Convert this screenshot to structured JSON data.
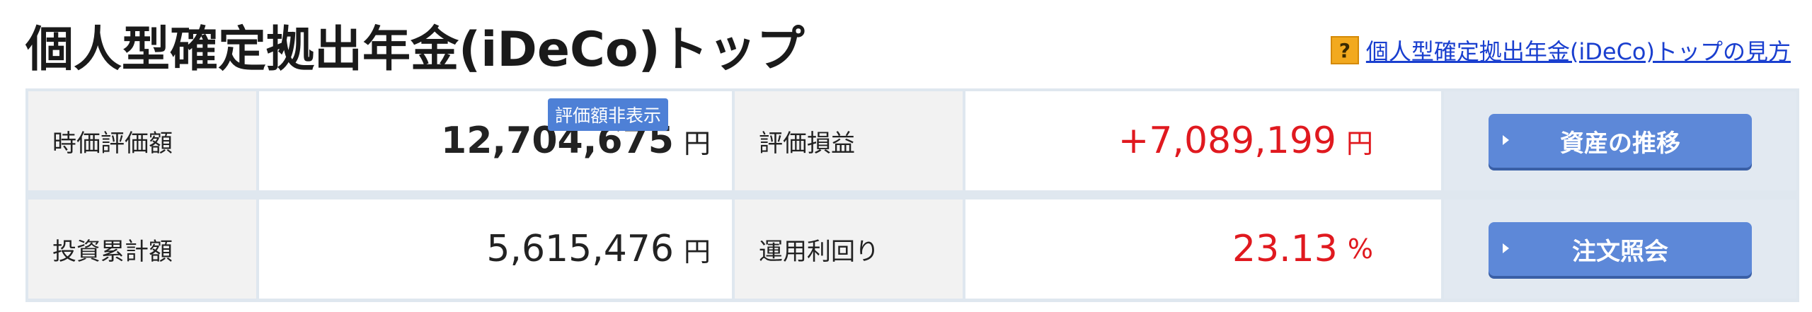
{
  "header": {
    "title": "個人型確定拠出年金(iDeCo)トップ",
    "help_icon": "?",
    "help_link": "個人型確定拠出年金(iDeCo)トップの見方"
  },
  "summary": {
    "market_value": {
      "label": "時価評価額",
      "value": "12,704,675",
      "unit": "円",
      "hide_button": "評価額非表示"
    },
    "gain": {
      "label": "評価損益",
      "value": "+7,089,199",
      "unit": "円"
    },
    "invested": {
      "label": "投資累計額",
      "value": "5,615,476",
      "unit": "円"
    },
    "yield": {
      "label": "運用利回り",
      "value": "23.13",
      "unit": "%"
    }
  },
  "actions": {
    "asset_trend": "資産の推移",
    "order_inquiry": "注文照会"
  },
  "colors": {
    "accent": "#5d88d8",
    "negative_positive_red": "#e0191f",
    "link": "#1a3fcf"
  }
}
